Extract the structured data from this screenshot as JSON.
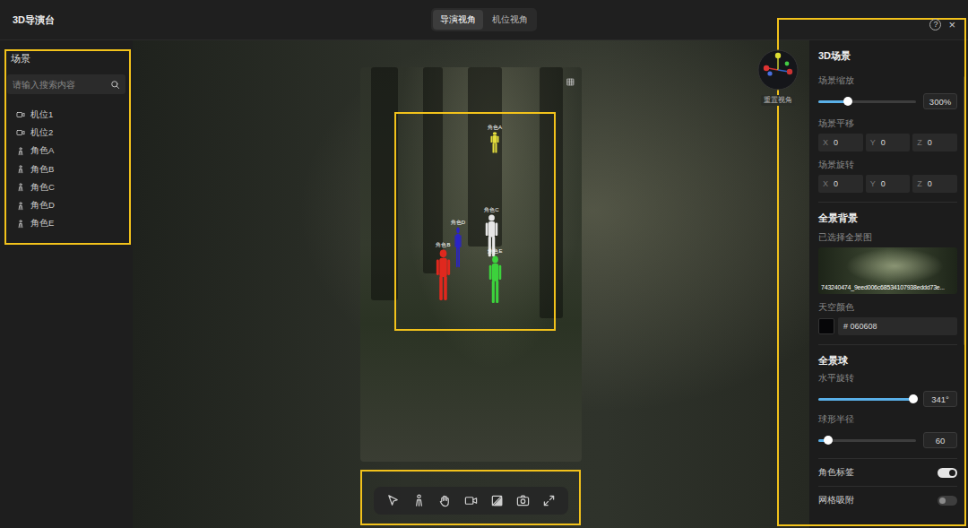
{
  "window": {
    "title": "3D导演台",
    "help": "?",
    "close": "×"
  },
  "tabs": [
    {
      "label": "导演视角",
      "selected": true
    },
    {
      "label": "机位视角",
      "selected": false
    }
  ],
  "scene_panel": {
    "title": "场景",
    "search": {
      "placeholder": "请输入搜索内容"
    },
    "items": [
      {
        "label": "机位1",
        "kind": "camera"
      },
      {
        "label": "机位2",
        "kind": "camera"
      },
      {
        "label": "角色A",
        "kind": "character"
      },
      {
        "label": "角色B",
        "kind": "character"
      },
      {
        "label": "角色C",
        "kind": "character"
      },
      {
        "label": "角色D",
        "kind": "character"
      },
      {
        "label": "角色E",
        "kind": "character"
      }
    ]
  },
  "viewport": {
    "reset_view": "重置视角",
    "figures": [
      {
        "label": "角色A",
        "color": "#e2dc3c"
      },
      {
        "label": "角色D",
        "color": "#2a24c8"
      },
      {
        "label": "角色C",
        "color": "#e6e6e6"
      },
      {
        "label": "角色B",
        "color": "#e0281e"
      },
      {
        "label": "角色E",
        "color": "#3cd23c"
      }
    ]
  },
  "properties": {
    "title": "3D场景",
    "scale": {
      "label": "场景缩放",
      "level": 0.3,
      "reading": "300%"
    },
    "translate": {
      "label": "场景平移",
      "fields": [
        {
          "axis": "X",
          "value": "0"
        },
        {
          "axis": "Y",
          "value": "0"
        },
        {
          "axis": "Z",
          "value": "0"
        }
      ]
    },
    "rotate": {
      "label": "场景旋转",
      "fields": [
        {
          "axis": "X",
          "value": "0"
        },
        {
          "axis": "Y",
          "value": "0"
        },
        {
          "axis": "Z",
          "value": "0"
        }
      ]
    },
    "panorama": {
      "title": "全景背景",
      "selected_label": "已选择全景图",
      "file": "743240474_9eed006c68534107938eddd73e...",
      "sky_label": "天空颜色",
      "sky_color": "#060608",
      "sky_value": "# 060608"
    },
    "sphere": {
      "title": "全景球",
      "rotation": {
        "label": "水平旋转",
        "level": 0.97,
        "reading": "341°"
      },
      "radius": {
        "label": "球形半径",
        "level": 0.1,
        "reading": "60"
      }
    },
    "toggles": [
      {
        "label": "角色标签",
        "on": true
      },
      {
        "label": "网格吸附",
        "on": false
      }
    ]
  }
}
